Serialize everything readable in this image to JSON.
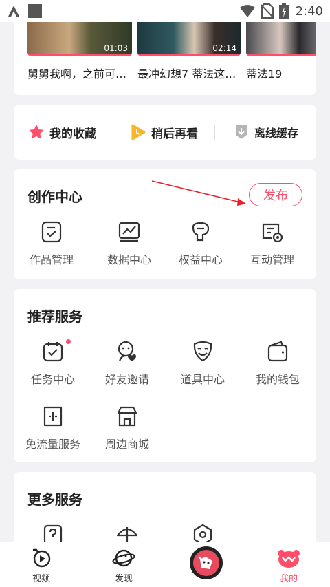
{
  "status_bar": {
    "time": "2:40",
    "icons": [
      "app-a-icon",
      "square-icon",
      "wifi-icon",
      "no-sim-icon",
      "battery-charging-icon"
    ]
  },
  "videos": [
    {
      "title": "舅舅我啊，之前可…",
      "duration": "01:03"
    },
    {
      "title": "最冲幻想7 蒂法这…",
      "duration": "02:14"
    },
    {
      "title": "蒂法19",
      "duration": ""
    }
  ],
  "quick_actions": [
    {
      "label": "我的收藏",
      "icon": "star-icon",
      "color": "#ff4d6a"
    },
    {
      "label": "稍后再看",
      "icon": "play-later-icon",
      "color": "#f7b52c"
    },
    {
      "label": "离线缓存",
      "icon": "download-icon",
      "color": "#aaaaaa"
    }
  ],
  "creation_center": {
    "title": "创作中心",
    "publish_label": "发布",
    "items": [
      {
        "label": "作品管理",
        "icon": "works-manage-icon"
      },
      {
        "label": "数据中心",
        "icon": "data-chart-icon"
      },
      {
        "label": "权益中心",
        "icon": "rights-icon"
      },
      {
        "label": "互动管理",
        "icon": "interaction-icon"
      }
    ]
  },
  "recommend_services": {
    "title": "推荐服务",
    "items": [
      {
        "label": "任务中心",
        "icon": "task-calendar-icon"
      },
      {
        "label": "好友邀请",
        "icon": "friend-invite-icon"
      },
      {
        "label": "道具中心",
        "icon": "mask-icon"
      },
      {
        "label": "我的钱包",
        "icon": "wallet-icon"
      },
      {
        "label": "免流量服务",
        "icon": "sim-card-icon"
      },
      {
        "label": "周边商城",
        "icon": "shop-icon"
      }
    ]
  },
  "more_services": {
    "title": "更多服务",
    "items": [
      {
        "icon": "help-icon"
      },
      {
        "icon": "umbrella-icon"
      },
      {
        "icon": "settings-icon"
      }
    ]
  },
  "bottom_nav": [
    {
      "label": "视频",
      "icon": "video-tab-icon",
      "active": false
    },
    {
      "label": "发现",
      "icon": "planet-icon",
      "active": false
    },
    {
      "label": "",
      "icon": "center-mascot-icon",
      "active": false
    },
    {
      "label": "我的",
      "icon": "bear-profile-icon",
      "active": true
    }
  ],
  "colors": {
    "accent": "#ff4d6a",
    "background": "#f2f2f4"
  }
}
